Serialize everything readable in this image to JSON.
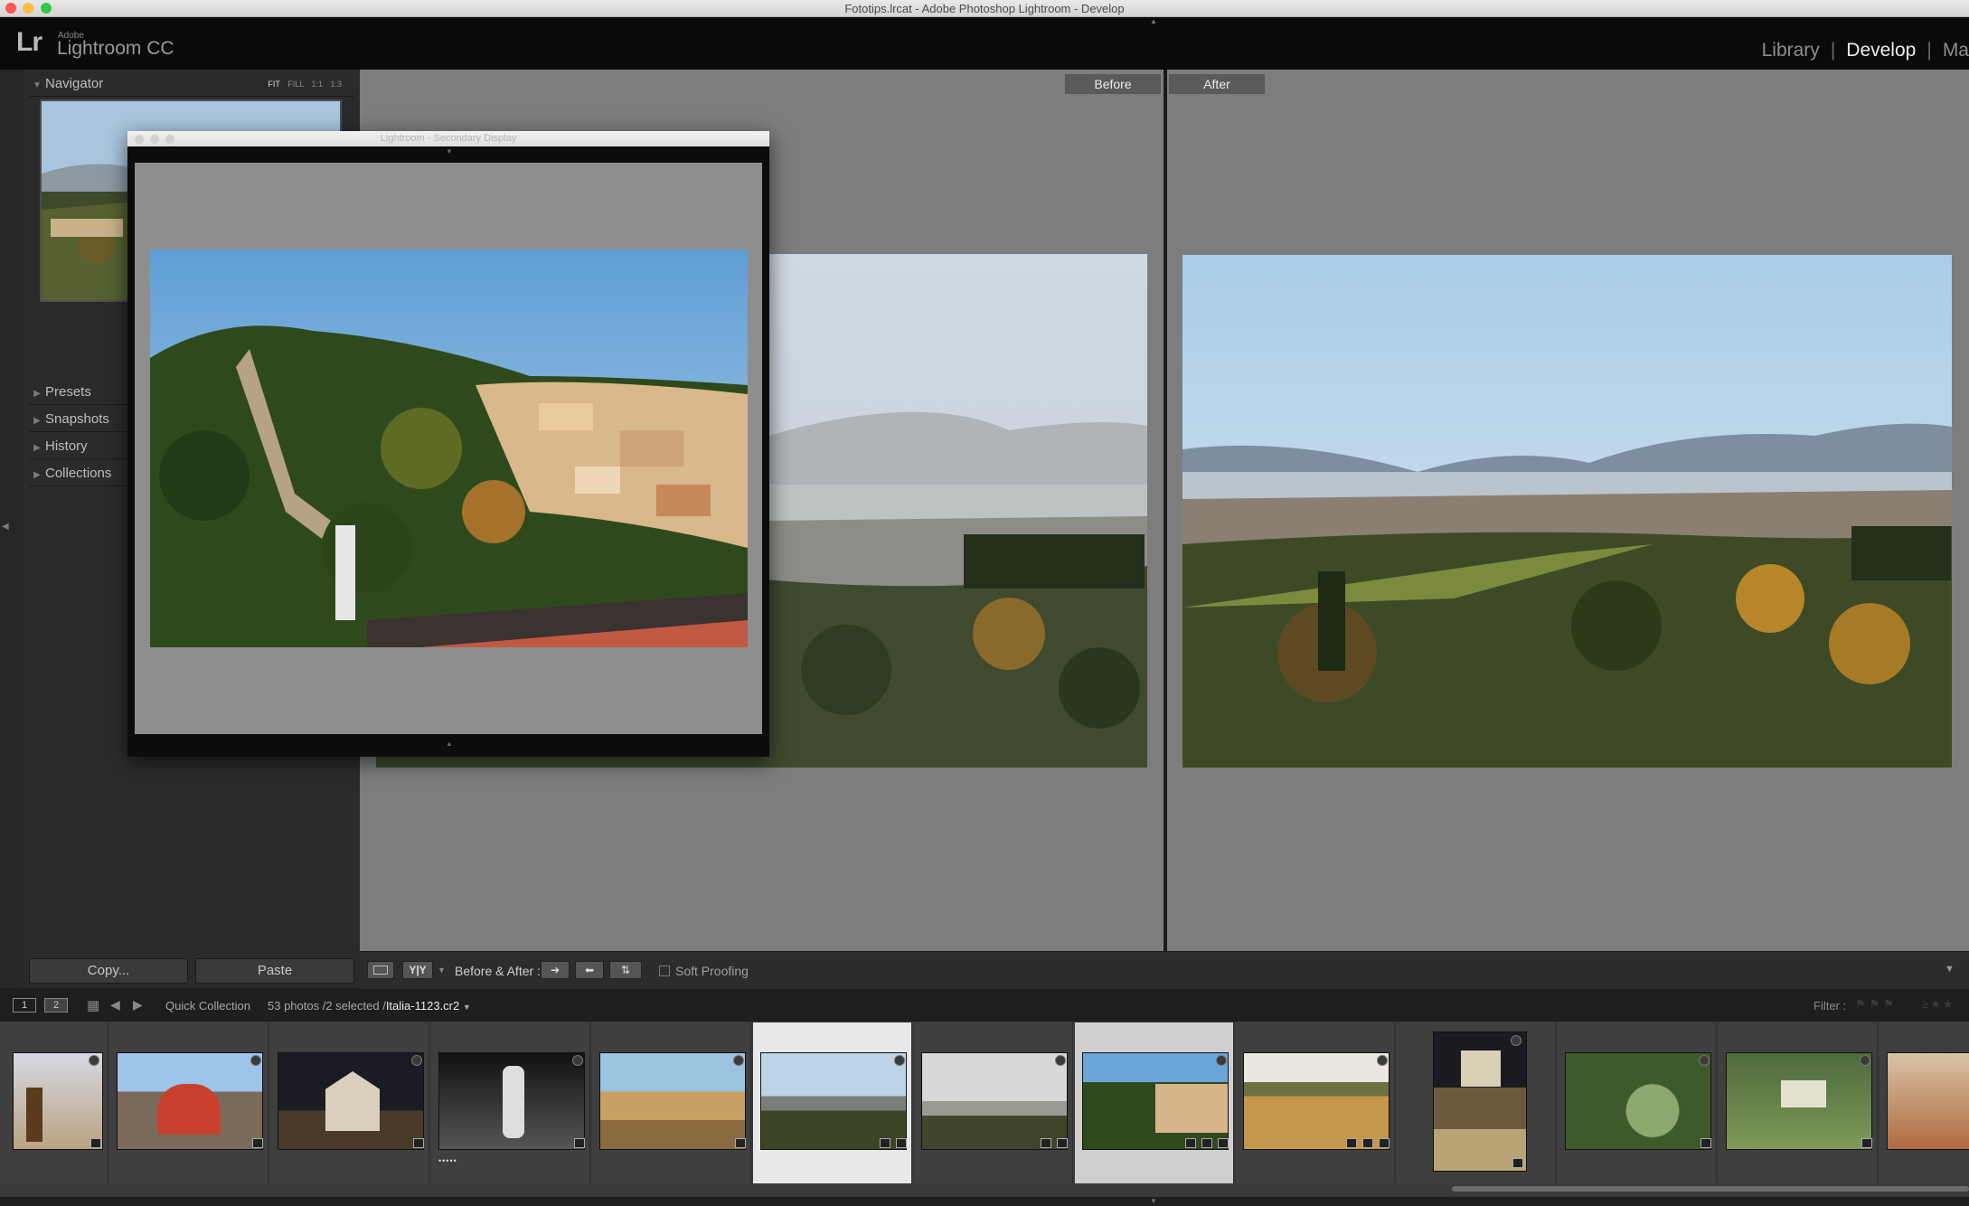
{
  "window": {
    "title": "Fototips.lrcat - Adobe Photoshop Lightroom - Develop"
  },
  "identity": {
    "logo": "Lr",
    "adobe": "Adobe",
    "product": "Lightroom CC"
  },
  "modules": [
    "Library",
    "Develop",
    "Ma"
  ],
  "active_module": "Develop",
  "left_panel": {
    "navigator": {
      "label": "Navigator",
      "zoom": [
        "FIT",
        "FILL",
        "1:1",
        "1:3"
      ]
    },
    "sections": [
      "Presets",
      "Snapshots",
      "History",
      "Collections"
    ],
    "copy_label": "Copy...",
    "paste_label": "Paste"
  },
  "view": {
    "before_label": "Before",
    "after_label": "After"
  },
  "secondary_window": {
    "title": "Lightroom - Secondary Display"
  },
  "toolbar": {
    "view_mode": "Y|Y",
    "before_after_label": "Before & After :",
    "soft_proofing_label": "Soft Proofing",
    "soft_proofing_checked": false
  },
  "filmstrip_header": {
    "screen1": "1",
    "screen2": "2",
    "source": "Quick Collection",
    "count": "53 photos /2 selected /",
    "current_file": "Italia-1123.cr2",
    "filter_label": "Filter :"
  },
  "filmstrip": {
    "thumbnails": [
      {
        "subject": "statue-sunset",
        "state": "normal",
        "stars": ""
      },
      {
        "subject": "carousel",
        "state": "normal",
        "stars": ""
      },
      {
        "subject": "church-night",
        "state": "normal",
        "stars": ""
      },
      {
        "subject": "fountain-bw",
        "state": "normal",
        "stars": "•••••"
      },
      {
        "subject": "riverside",
        "state": "normal",
        "stars": ""
      },
      {
        "subject": "valley-mist",
        "state": "selected",
        "stars": ""
      },
      {
        "subject": "valley-haze",
        "state": "normal",
        "stars": ""
      },
      {
        "subject": "florence-hill",
        "state": "most-selected",
        "stars": ""
      },
      {
        "subject": "wheat-field",
        "state": "normal",
        "stars": ""
      },
      {
        "subject": "steps-night",
        "state": "normal",
        "stars": ""
      },
      {
        "subject": "garden-aerial",
        "state": "normal",
        "stars": ""
      },
      {
        "subject": "villa-aerial",
        "state": "normal",
        "stars": ""
      },
      {
        "subject": "rooftops",
        "state": "normal",
        "stars": ""
      }
    ]
  },
  "colors": {
    "accent_selected": "#e8e8e8",
    "panel": "#2b2b2b",
    "canvas": "#7d7d7d"
  }
}
